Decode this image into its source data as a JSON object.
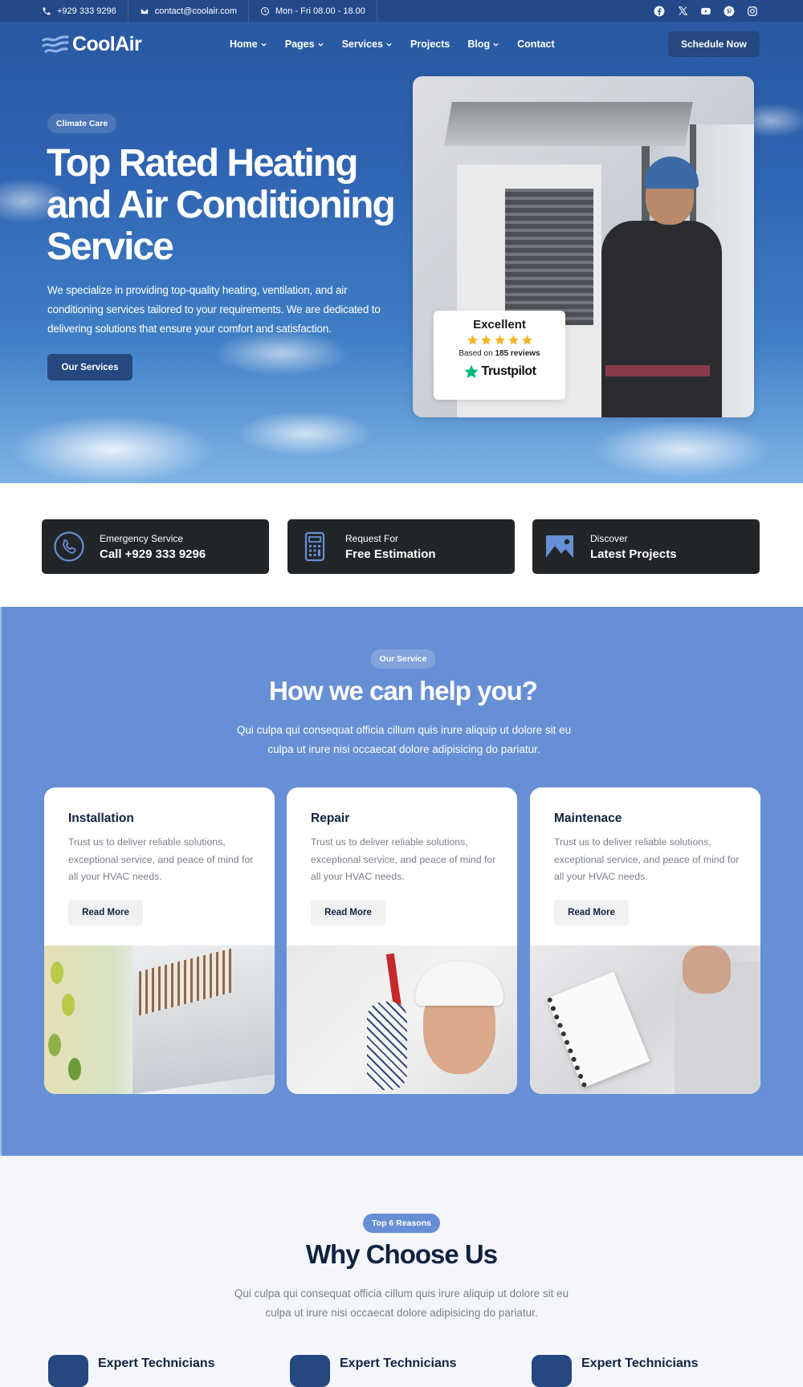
{
  "topbar": {
    "phone": "+929 333 9296",
    "email": "contact@coolair.com",
    "hours": "Mon - Fri 08.00 - 18.00",
    "social": [
      "facebook-icon",
      "x-icon",
      "youtube-icon",
      "pinterest-icon",
      "instagram-icon"
    ]
  },
  "nav": {
    "logo": "CoolAir",
    "items": [
      {
        "label": "Home",
        "dropdown": true
      },
      {
        "label": "Pages",
        "dropdown": true
      },
      {
        "label": "Services",
        "dropdown": true
      },
      {
        "label": "Projects",
        "dropdown": false
      },
      {
        "label": "Blog",
        "dropdown": true
      },
      {
        "label": "Contact",
        "dropdown": false
      }
    ],
    "cta": "Schedule Now"
  },
  "hero": {
    "tag": "Climate Care",
    "title": "Top Rated Heating and Air Conditioning Service",
    "description": "We specialize in providing top-quality heating, ventilation, and air conditioning services tailored to your requirements. We are dedicated to delivering solutions that ensure your comfort and satisfaction.",
    "button": "Our Services",
    "review": {
      "rating_label": "Excellent",
      "stars": 5,
      "based_prefix": "Based on",
      "count_label": "185 reviews",
      "platform": "Trustpilot"
    }
  },
  "features": [
    {
      "icon": "phone-circle-icon",
      "small": "Emergency Service",
      "big": "Call +929 333 9296"
    },
    {
      "icon": "calculator-icon",
      "small": "Request For",
      "big": "Free Estimation"
    },
    {
      "icon": "image-icon",
      "small": "Discover",
      "big": "Latest Projects"
    }
  ],
  "services": {
    "tag": "Our Service",
    "title": "How we can help you?",
    "description": "Qui culpa qui consequat officia cillum quis irure aliquip ut dolore sit eu culpa ut irure nisi occaecat dolore adipisicing do pariatur.",
    "cards": [
      {
        "title": "Installation",
        "description": "Trust us to deliver reliable solutions, exceptional service, and peace of mind for all your HVAC needs.",
        "button": "Read More"
      },
      {
        "title": "Repair",
        "description": "Trust us to deliver reliable solutions, exceptional service, and peace of mind for all your HVAC needs.",
        "button": "Read More"
      },
      {
        "title": "Maintenace",
        "description": "Trust us to deliver reliable solutions, exceptional service, and peace of mind for all your HVAC needs.",
        "button": "Read More"
      }
    ]
  },
  "why": {
    "tag": "Top 6 Reasons",
    "title": "Why Choose Us",
    "description": "Qui culpa qui consequat officia cillum quis irure aliquip ut dolore sit eu culpa ut irure nisi occaecat dolore adipisicing do pariatur.",
    "reasons": [
      {
        "title": "Expert Technicians"
      },
      {
        "title": "Expert Technicians"
      },
      {
        "title": "Expert Technicians"
      }
    ]
  },
  "colors": {
    "primary_dark": "#24487f",
    "service_bg": "#678fd5",
    "dark_box": "#222528",
    "heading": "#0f2340",
    "star": "#f5b324",
    "trustpilot_green": "#00b67a"
  }
}
